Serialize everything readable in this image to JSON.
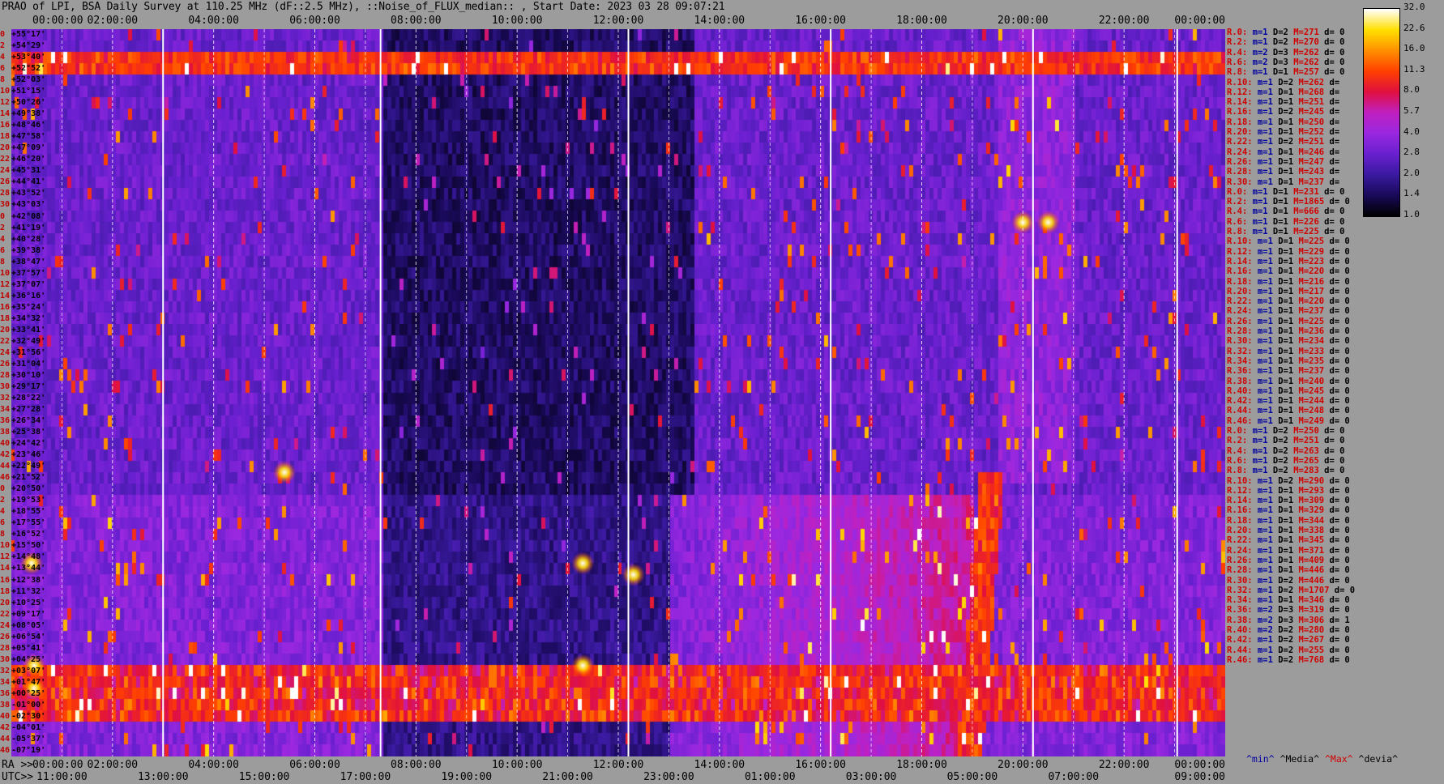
{
  "title": "PRAO of LPI, BSA Daily Survey at 110.25 MHz (dF::2.5 MHz), ::Noise_of_FLUX_median:: , Start Date: 2023 03 28 09:07:21",
  "ra_label": "RA >>",
  "utc_label": "UTC>>",
  "legend_footer": {
    "min": "^min^",
    "median": "^Media^",
    "max": "^Max^",
    "devia": "^devia^"
  },
  "chart_data": {
    "type": "heatmap",
    "top_axis_ticks": [
      "00:00:00",
      "02:00:00",
      "04:00:00",
      "06:00:00",
      "08:00:00",
      "10:00:00",
      "12:00:00",
      "14:00:00",
      "16:00:00",
      "18:00:00",
      "20:00:00",
      "22:00:00",
      "00:00:00"
    ],
    "ra_ticks": [
      "00:00:00",
      "02:00:00",
      "04:00:00",
      "06:00:00",
      "08:00:00",
      "10:00:00",
      "12:00:00",
      "14:00:00",
      "16:00:00",
      "18:00:00",
      "20:00:00",
      "22:00:00",
      "00:00:00"
    ],
    "utc_ticks": [
      "11:00:00",
      "13:00:00",
      "15:00:00",
      "17:00:00",
      "19:00:00",
      "21:00:00",
      "23:00:00",
      "01:00:00",
      "03:00:00",
      "05:00:00",
      "07:00:00",
      "09:00:00"
    ],
    "dec_labels": [
      "+55°17'",
      "+54°29'",
      "+53°40'",
      "+52°52'",
      "+52°03'",
      "+51°15'",
      "+50°26'",
      "+49°38'",
      "+48°46'",
      "+47°58'",
      "+47°09'",
      "+46°20'",
      "+45°31'",
      "+44°41'",
      "+43°52'",
      "+43°03'",
      "+42°08'",
      "+41°19'",
      "+40°28'",
      "+39°38'",
      "+38°47'",
      "+37°57'",
      "+37°07'",
      "+36°16'",
      "+35°24'",
      "+34°32'",
      "+33°41'",
      "+32°49'",
      "+31°56'",
      "+31°04'",
      "+30°10'",
      "+29°17'",
      "+28°22'",
      "+27°28'",
      "+26°34'",
      "+25°38'",
      "+24°42'",
      "+23°46'",
      "+22°49'",
      "+21°52'",
      "+20°50'",
      "+19°53'",
      "+18°55'",
      "+17°55'",
      "+16°52'",
      "+15°50'",
      "+14°48'",
      "+13°44'",
      "+12°38'",
      "+11°32'",
      "+10°25'",
      "+09°17'",
      "+08°05'",
      "+06°54'",
      "+05°41'",
      "+04°25'",
      "+03°07'",
      "+01°47'",
      "+00°25'",
      "-01°00'",
      "-02°30'",
      "-04°01'",
      "-05°37'",
      "-07°19'"
    ],
    "dec_index": [
      "0",
      "2",
      "4",
      "6",
      "8",
      "10",
      "12",
      "14",
      "16",
      "18",
      "20",
      "22",
      "24",
      "26",
      "28",
      "30",
      "0",
      "2",
      "4",
      "6",
      "8",
      "10",
      "12",
      "14",
      "16",
      "18",
      "20",
      "22",
      "24",
      "26",
      "28",
      "30",
      "32",
      "34",
      "36",
      "38",
      "40",
      "42",
      "44",
      "46",
      "0",
      "2",
      "4",
      "6",
      "8",
      "10",
      "12",
      "14",
      "16",
      "18",
      "20",
      "22",
      "24",
      "26",
      "28",
      "30",
      "32",
      "34",
      "36",
      "38",
      "40",
      "42",
      "44",
      "46"
    ],
    "colorbar": {
      "ticks": [
        "32.0",
        "22.6",
        "16.0",
        "11.3",
        "8.0",
        "5.7",
        "4.0",
        "2.8",
        "2.0",
        "1.4",
        "1.0"
      ],
      "scale": "log",
      "range": [
        1.0,
        32.0
      ]
    },
    "colormap": [
      "#000000",
      "#1a0a5a",
      "#3a1aa0",
      "#6a20d0",
      "#9a28e0",
      "#c020c0",
      "#e01040",
      "#ff4000",
      "#ff9000",
      "#ffe000",
      "#ffffff"
    ],
    "right_stats": [
      {
        "r": "R.0:",
        "m": "m=1",
        "d": "D=2",
        "M": "M=271",
        "dv": "d= 0"
      },
      {
        "r": "R.2:",
        "m": "m=1",
        "d": "D=2",
        "M": "M=270",
        "dv": "d= 0"
      },
      {
        "r": "R.4:",
        "m": "m=2",
        "d": "D=3",
        "M": "M=262",
        "dv": "d= 0"
      },
      {
        "r": "R.6:",
        "m": "m=2",
        "d": "D=3",
        "M": "M=262",
        "dv": "d= 0"
      },
      {
        "r": "R.8:",
        "m": "m=1",
        "d": "D=1",
        "M": "M=257",
        "dv": "d= 0"
      },
      {
        "r": "R.10:",
        "m": "m=1",
        "d": "D=2",
        "M": "M=262",
        "dv": "d="
      },
      {
        "r": "R.12:",
        "m": "m=1",
        "d": "D=1",
        "M": "M=268",
        "dv": "d="
      },
      {
        "r": "R.14:",
        "m": "m=1",
        "d": "D=1",
        "M": "M=251",
        "dv": "d="
      },
      {
        "r": "R.16:",
        "m": "m=1",
        "d": "D=2",
        "M": "M=245",
        "dv": "d="
      },
      {
        "r": "R.18:",
        "m": "m=1",
        "d": "D=1",
        "M": "M=250",
        "dv": "d="
      },
      {
        "r": "R.20:",
        "m": "m=1",
        "d": "D=1",
        "M": "M=252",
        "dv": "d="
      },
      {
        "r": "R.22:",
        "m": "m=1",
        "d": "D=2",
        "M": "M=251",
        "dv": "d="
      },
      {
        "r": "R.24:",
        "m": "m=1",
        "d": "D=1",
        "M": "M=246",
        "dv": "d="
      },
      {
        "r": "R.26:",
        "m": "m=1",
        "d": "D=1",
        "M": "M=247",
        "dv": "d="
      },
      {
        "r": "R.28:",
        "m": "m=1",
        "d": "D=1",
        "M": "M=243",
        "dv": "d="
      },
      {
        "r": "R.30:",
        "m": "m=1",
        "d": "D=1",
        "M": "M=237",
        "dv": "d="
      },
      {
        "r": "R.0:",
        "m": "m=1",
        "d": "D=1",
        "M": "M=231",
        "dv": "d= 0"
      },
      {
        "r": "R.2:",
        "m": "m=1",
        "d": "D=1",
        "M": "M=1865",
        "dv": "d= 0"
      },
      {
        "r": "R.4:",
        "m": "m=1",
        "d": "D=1",
        "M": "M=666",
        "dv": "d= 0"
      },
      {
        "r": "R.6:",
        "m": "m=1",
        "d": "D=1",
        "M": "M=226",
        "dv": "d= 0"
      },
      {
        "r": "R.8:",
        "m": "m=1",
        "d": "D=1",
        "M": "M=225",
        "dv": "d= 0"
      },
      {
        "r": "R.10:",
        "m": "m=1",
        "d": "D=1",
        "M": "M=225",
        "dv": "d= 0"
      },
      {
        "r": "R.12:",
        "m": "m=1",
        "d": "D=1",
        "M": "M=229",
        "dv": "d= 0"
      },
      {
        "r": "R.14:",
        "m": "m=1",
        "d": "D=1",
        "M": "M=223",
        "dv": "d= 0"
      },
      {
        "r": "R.16:",
        "m": "m=1",
        "d": "D=1",
        "M": "M=220",
        "dv": "d= 0"
      },
      {
        "r": "R.18:",
        "m": "m=1",
        "d": "D=1",
        "M": "M=216",
        "dv": "d= 0"
      },
      {
        "r": "R.20:",
        "m": "m=1",
        "d": "D=1",
        "M": "M=217",
        "dv": "d= 0"
      },
      {
        "r": "R.22:",
        "m": "m=1",
        "d": "D=1",
        "M": "M=220",
        "dv": "d= 0"
      },
      {
        "r": "R.24:",
        "m": "m=1",
        "d": "D=1",
        "M": "M=237",
        "dv": "d= 0"
      },
      {
        "r": "R.26:",
        "m": "m=1",
        "d": "D=1",
        "M": "M=225",
        "dv": "d= 0"
      },
      {
        "r": "R.28:",
        "m": "m=1",
        "d": "D=1",
        "M": "M=236",
        "dv": "d= 0"
      },
      {
        "r": "R.30:",
        "m": "m=1",
        "d": "D=1",
        "M": "M=234",
        "dv": "d= 0"
      },
      {
        "r": "R.32:",
        "m": "m=1",
        "d": "D=1",
        "M": "M=233",
        "dv": "d= 0"
      },
      {
        "r": "R.34:",
        "m": "m=1",
        "d": "D=1",
        "M": "M=235",
        "dv": "d= 0"
      },
      {
        "r": "R.36:",
        "m": "m=1",
        "d": "D=1",
        "M": "M=237",
        "dv": "d= 0"
      },
      {
        "r": "R.38:",
        "m": "m=1",
        "d": "D=1",
        "M": "M=240",
        "dv": "d= 0"
      },
      {
        "r": "R.40:",
        "m": "m=1",
        "d": "D=1",
        "M": "M=245",
        "dv": "d= 0"
      },
      {
        "r": "R.42:",
        "m": "m=1",
        "d": "D=1",
        "M": "M=244",
        "dv": "d= 0"
      },
      {
        "r": "R.44:",
        "m": "m=1",
        "d": "D=1",
        "M": "M=248",
        "dv": "d= 0"
      },
      {
        "r": "R.46:",
        "m": "m=1",
        "d": "D=1",
        "M": "M=249",
        "dv": "d= 0"
      },
      {
        "r": "R.0:",
        "m": "m=1",
        "d": "D=2",
        "M": "M=250",
        "dv": "d= 0"
      },
      {
        "r": "R.2:",
        "m": "m=1",
        "d": "D=2",
        "M": "M=251",
        "dv": "d= 0"
      },
      {
        "r": "R.4:",
        "m": "m=1",
        "d": "D=2",
        "M": "M=263",
        "dv": "d= 0"
      },
      {
        "r": "R.6:",
        "m": "m=1",
        "d": "D=2",
        "M": "M=265",
        "dv": "d= 0"
      },
      {
        "r": "R.8:",
        "m": "m=1",
        "d": "D=2",
        "M": "M=283",
        "dv": "d= 0"
      },
      {
        "r": "R.10:",
        "m": "m=1",
        "d": "D=2",
        "M": "M=290",
        "dv": "d= 0"
      },
      {
        "r": "R.12:",
        "m": "m=1",
        "d": "D=1",
        "M": "M=293",
        "dv": "d= 0"
      },
      {
        "r": "R.14:",
        "m": "m=1",
        "d": "D=1",
        "M": "M=309",
        "dv": "d= 0"
      },
      {
        "r": "R.16:",
        "m": "m=1",
        "d": "D=1",
        "M": "M=329",
        "dv": "d= 0"
      },
      {
        "r": "R.18:",
        "m": "m=1",
        "d": "D=1",
        "M": "M=344",
        "dv": "d= 0"
      },
      {
        "r": "R.20:",
        "m": "m=1",
        "d": "D=1",
        "M": "M=338",
        "dv": "d= 0"
      },
      {
        "r": "R.22:",
        "m": "m=1",
        "d": "D=1",
        "M": "M=345",
        "dv": "d= 0"
      },
      {
        "r": "R.24:",
        "m": "m=1",
        "d": "D=1",
        "M": "M=371",
        "dv": "d= 0"
      },
      {
        "r": "R.26:",
        "m": "m=1",
        "d": "D=1",
        "M": "M=409",
        "dv": "d= 0"
      },
      {
        "r": "R.28:",
        "m": "m=1",
        "d": "D=1",
        "M": "M=446",
        "dv": "d= 0"
      },
      {
        "r": "R.30:",
        "m": "m=1",
        "d": "D=2",
        "M": "M=446",
        "dv": "d= 0"
      },
      {
        "r": "R.32:",
        "m": "m=1",
        "d": "D=2",
        "M": "M=1707",
        "dv": "d= 0"
      },
      {
        "r": "R.34:",
        "m": "m=1",
        "d": "D=1",
        "M": "M=346",
        "dv": "d= 0"
      },
      {
        "r": "R.36:",
        "m": "m=2",
        "d": "D=3",
        "M": "M=319",
        "dv": "d= 0"
      },
      {
        "r": "R.38:",
        "m": "m=2",
        "d": "D=3",
        "M": "M=306",
        "dv": "d= 1"
      },
      {
        "r": "R.40:",
        "m": "m=2",
        "d": "D=2",
        "M": "M=280",
        "dv": "d= 0"
      },
      {
        "r": "R.42:",
        "m": "m=1",
        "d": "D=2",
        "M": "M=267",
        "dv": "d= 0"
      },
      {
        "r": "R.44:",
        "m": "m=1",
        "d": "D=2",
        "M": "M=255",
        "dv": "d= 0"
      },
      {
        "r": "R.46:",
        "m": "m=1",
        "d": "D=2",
        "M": "M=768",
        "dv": "d= 0"
      }
    ]
  }
}
